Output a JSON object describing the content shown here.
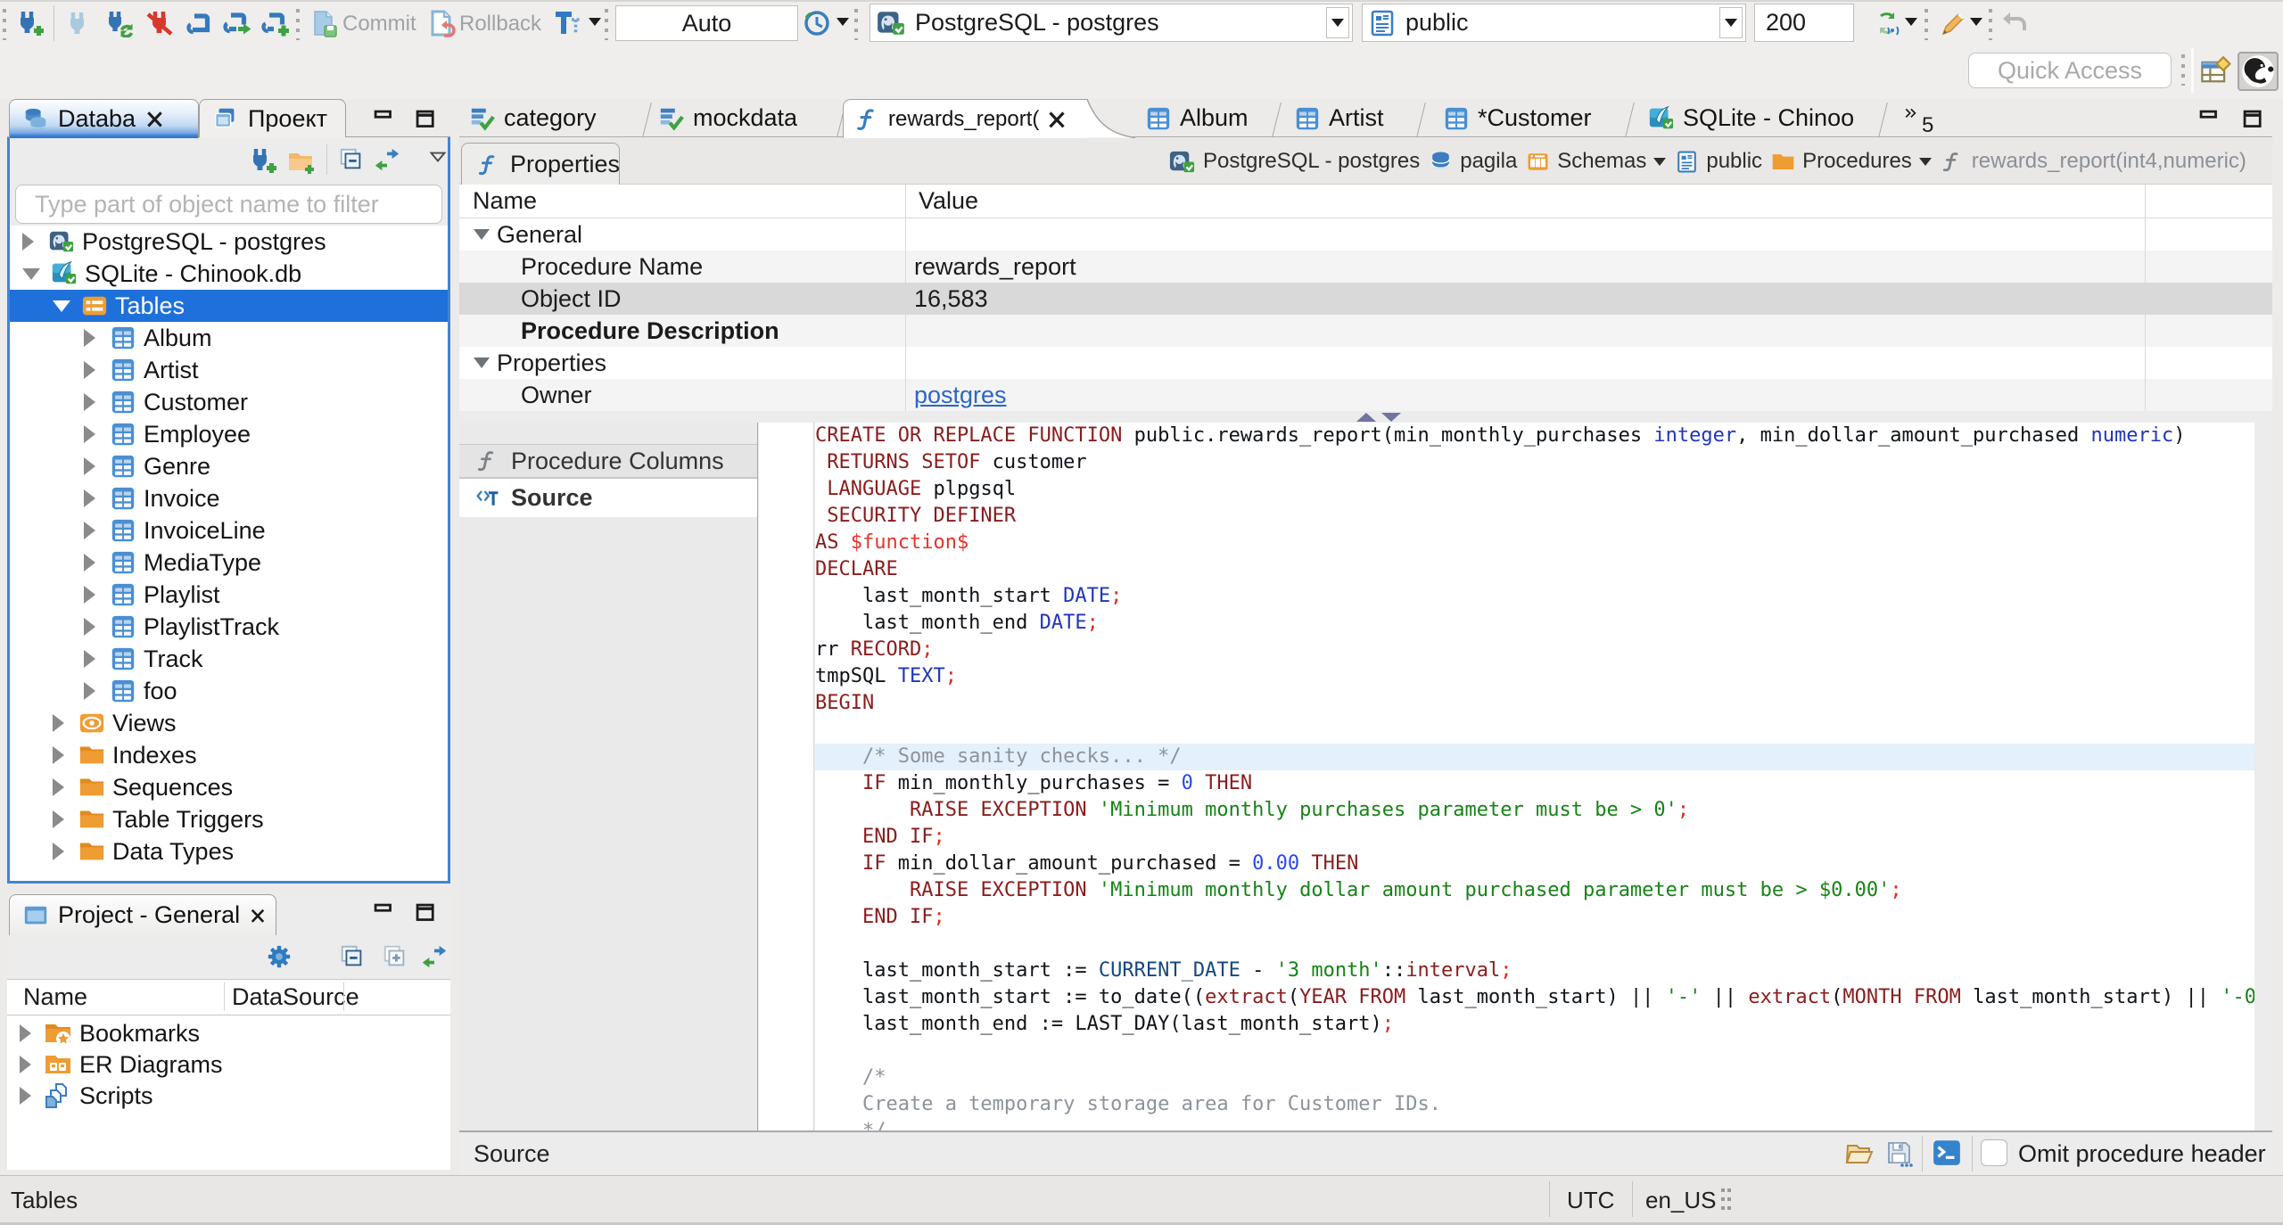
{
  "colors": {
    "selection_blue": "#1e70db",
    "focus_border_blue": "#4285d2",
    "icon_blue": "#3a7dc2",
    "folder_orange": "#ef9c33",
    "accent_green": "#3fa142",
    "accent_red": "#d64541",
    "code_keyword": "#8b1c1c",
    "code_type": "#2036b8",
    "code_number": "#2a49e8",
    "code_string": "#168316",
    "code_comment": "#8d939b",
    "code_delimiter": "#e02a22",
    "code_dollar_quote": "#e5342b",
    "code_builtin": "#15477f"
  },
  "toolbar": {
    "buttons": [
      {
        "icon": "plug-new-icon",
        "name": "new-connection-button"
      },
      {
        "icon": "plug-idle-icon",
        "name": "connect-button"
      },
      {
        "icon": "plug-refresh-icon",
        "name": "invalidate-connection-button"
      },
      {
        "icon": "plug-disconnect-icon",
        "name": "disconnect-button"
      },
      {
        "icon": "sql-editor-icon",
        "name": "sql-editor-button"
      },
      {
        "icon": "sql-editor-open-icon",
        "name": "open-sql-script-button"
      },
      {
        "icon": "sql-editor-new-icon",
        "name": "new-sql-editor-button"
      }
    ],
    "commit_label": "Commit",
    "rollback_label": "Rollback",
    "tx_mode_combo": "Auto",
    "connection_combo": "PostgreSQL - postgres",
    "schema_combo": "public",
    "fetch_size_value": "200",
    "quick_access_placeholder": "Quick Access"
  },
  "left_view_tabs": [
    {
      "label": "Databa",
      "icon": "database-stack-icon",
      "closable": true,
      "selected": true
    },
    {
      "label": "Проект",
      "icon": "projects-icon",
      "closable": false,
      "selected": false
    }
  ],
  "navigator": {
    "filter_placeholder": "Type part of object name to filter",
    "tree": [
      {
        "label": "PostgreSQL - postgres",
        "icon": "postgres-connection-icon",
        "level": 0,
        "arrow": "right"
      },
      {
        "label": "SQLite - Chinook.db",
        "icon": "sqlite-connection-icon",
        "level": 0,
        "arrow": "down"
      },
      {
        "label": "Tables",
        "icon": "tables-folder-icon",
        "level": 1,
        "arrow": "down",
        "selected": true
      },
      {
        "label": "Album",
        "icon": "table-icon",
        "level": 2,
        "arrow": "right"
      },
      {
        "label": "Artist",
        "icon": "table-icon",
        "level": 2,
        "arrow": "right"
      },
      {
        "label": "Customer",
        "icon": "table-icon",
        "level": 2,
        "arrow": "right"
      },
      {
        "label": "Employee",
        "icon": "table-icon",
        "level": 2,
        "arrow": "right"
      },
      {
        "label": "Genre",
        "icon": "table-icon",
        "level": 2,
        "arrow": "right"
      },
      {
        "label": "Invoice",
        "icon": "table-icon",
        "level": 2,
        "arrow": "right"
      },
      {
        "label": "InvoiceLine",
        "icon": "table-icon",
        "level": 2,
        "arrow": "right"
      },
      {
        "label": "MediaType",
        "icon": "table-icon",
        "level": 2,
        "arrow": "right"
      },
      {
        "label": "Playlist",
        "icon": "table-icon",
        "level": 2,
        "arrow": "right"
      },
      {
        "label": "PlaylistTrack",
        "icon": "table-icon",
        "level": 2,
        "arrow": "right"
      },
      {
        "label": "Track",
        "icon": "table-icon",
        "level": 2,
        "arrow": "right"
      },
      {
        "label": "foo",
        "icon": "table-icon",
        "level": 2,
        "arrow": "right"
      },
      {
        "label": "Views",
        "icon": "views-icon",
        "level": 1,
        "arrow": "right"
      },
      {
        "label": "Indexes",
        "icon": "folder-icon",
        "level": 1,
        "arrow": "right"
      },
      {
        "label": "Sequences",
        "icon": "folder-icon",
        "level": 1,
        "arrow": "right"
      },
      {
        "label": "Table Triggers",
        "icon": "folder-icon",
        "level": 1,
        "arrow": "right"
      },
      {
        "label": "Data Types",
        "icon": "folder-icon",
        "level": 1,
        "arrow": "right"
      }
    ]
  },
  "project_panel": {
    "title": "Project - General",
    "columns": [
      "Name",
      "DataSource"
    ],
    "items": [
      {
        "label": "Bookmarks",
        "icon": "bookmarks-folder-icon"
      },
      {
        "label": "ER Diagrams",
        "icon": "er-diagrams-icon"
      },
      {
        "label": "Scripts",
        "icon": "scripts-icon"
      }
    ]
  },
  "editor_tabs": [
    {
      "label": "category",
      "icon": "sql-script-icon"
    },
    {
      "label": "mockdata",
      "icon": "sql-script-icon"
    },
    {
      "label": "rewards_report(",
      "icon": "function-icon",
      "selected": true,
      "closable": true
    },
    {
      "label": "Album",
      "icon": "table-tab-icon"
    },
    {
      "label": "Artist",
      "icon": "table-tab-icon"
    },
    {
      "label": "*Customer",
      "icon": "table-tab-icon"
    },
    {
      "label": "SQLite - Chinoo",
      "icon": "sqlite-connection-icon"
    }
  ],
  "editor_tabs_overflow_count": "5",
  "properties_view_tab": "Properties",
  "breadcrumb": [
    {
      "label": "PostgreSQL - postgres",
      "icon": "postgres-connection-icon"
    },
    {
      "label": "pagila",
      "icon": "database-icon"
    },
    {
      "label": "Schemas",
      "icon": "schemas-icon",
      "dropdown": true
    },
    {
      "label": "public",
      "icon": "schema-page-icon"
    },
    {
      "label": "Procedures",
      "icon": "folder-plain-icon",
      "dropdown": true
    },
    {
      "label": "rewards_report(int4,numeric)",
      "icon": "function-gray-icon",
      "dim": true
    }
  ],
  "properties": {
    "columns": [
      "Name",
      "Value"
    ],
    "rows": [
      {
        "name": "General",
        "value": "",
        "group": true
      },
      {
        "name": "Procedure Name",
        "value": "rewards_report",
        "stripe": true
      },
      {
        "name": "Object ID",
        "value": "16,583",
        "selected": true
      },
      {
        "name": "Procedure Description",
        "value": "",
        "bold": true,
        "stripe": true
      },
      {
        "name": "Properties",
        "value": "",
        "group": true
      },
      {
        "name": "Owner",
        "value": "postgres",
        "stripe": true,
        "link": true
      }
    ]
  },
  "subtabs": [
    {
      "label": "Procedure Columns",
      "icon": "function-gray-icon"
    },
    {
      "label": "Source",
      "icon": "source-text-icon",
      "selected": true
    }
  ],
  "editor_footer": {
    "label": "Source",
    "icons": [
      "open-folder-icon",
      "save-floppy-icon",
      "terminal-icon"
    ],
    "checkbox_label": "Omit procedure header",
    "checkbox_checked": false
  },
  "statusbar": {
    "left": "Tables",
    "timezone": "UTC",
    "locale": "en_US"
  },
  "code": {
    "highlight_line": 13,
    "lines": [
      [
        {
          "t": "kw",
          "s": "CREATE OR REPLACE FUNCTION"
        },
        {
          "t": "plain",
          "s": " public.rewards_report(min_monthly_purchases "
        },
        {
          "t": "type",
          "s": "integer"
        },
        {
          "t": "plain",
          "s": ", min_dollar_amount_purchased "
        },
        {
          "t": "type",
          "s": "numeric"
        },
        {
          "t": "plain",
          "s": ")"
        }
      ],
      [
        {
          "t": "plain",
          "s": " "
        },
        {
          "t": "kw",
          "s": "RETURNS SETOF"
        },
        {
          "t": "plain",
          "s": " customer"
        }
      ],
      [
        {
          "t": "plain",
          "s": " "
        },
        {
          "t": "kw",
          "s": "LANGUAGE"
        },
        {
          "t": "plain",
          "s": " plpgsql"
        }
      ],
      [
        {
          "t": "plain",
          "s": " "
        },
        {
          "t": "kw",
          "s": "SECURITY DEFINER"
        }
      ],
      [
        {
          "t": "kw",
          "s": "AS"
        },
        {
          "t": "plain",
          "s": " "
        },
        {
          "t": "red",
          "s": "$function$"
        }
      ],
      [
        {
          "t": "kw",
          "s": "DECLARE"
        }
      ],
      [
        {
          "t": "plain",
          "s": "    last_month_start "
        },
        {
          "t": "type",
          "s": "DATE"
        },
        {
          "t": "delim",
          "s": ";"
        }
      ],
      [
        {
          "t": "plain",
          "s": "    last_month_end "
        },
        {
          "t": "type",
          "s": "DATE"
        },
        {
          "t": "delim",
          "s": ";"
        }
      ],
      [
        {
          "t": "plain",
          "s": "rr "
        },
        {
          "t": "kw",
          "s": "RECORD"
        },
        {
          "t": "delim",
          "s": ";"
        }
      ],
      [
        {
          "t": "plain",
          "s": "tmpSQL "
        },
        {
          "t": "type",
          "s": "TEXT"
        },
        {
          "t": "delim",
          "s": ";"
        }
      ],
      [
        {
          "t": "kw",
          "s": "BEGIN"
        }
      ],
      [],
      [
        {
          "t": "com",
          "s": "    /* Some sanity checks... */"
        }
      ],
      [
        {
          "t": "plain",
          "s": "    "
        },
        {
          "t": "kw",
          "s": "IF"
        },
        {
          "t": "plain",
          "s": " min_monthly_purchases = "
        },
        {
          "t": "num",
          "s": "0"
        },
        {
          "t": "plain",
          "s": " "
        },
        {
          "t": "kw",
          "s": "THEN"
        }
      ],
      [
        {
          "t": "plain",
          "s": "        "
        },
        {
          "t": "kw",
          "s": "RAISE EXCEPTION"
        },
        {
          "t": "plain",
          "s": " "
        },
        {
          "t": "str",
          "s": "'Minimum monthly purchases parameter must be > 0'"
        },
        {
          "t": "delim",
          "s": ";"
        }
      ],
      [
        {
          "t": "plain",
          "s": "    "
        },
        {
          "t": "kw",
          "s": "END IF"
        },
        {
          "t": "delim",
          "s": ";"
        }
      ],
      [
        {
          "t": "plain",
          "s": "    "
        },
        {
          "t": "kw",
          "s": "IF"
        },
        {
          "t": "plain",
          "s": " min_dollar_amount_purchased = "
        },
        {
          "t": "num",
          "s": "0.00"
        },
        {
          "t": "plain",
          "s": " "
        },
        {
          "t": "kw",
          "s": "THEN"
        }
      ],
      [
        {
          "t": "plain",
          "s": "        "
        },
        {
          "t": "kw",
          "s": "RAISE EXCEPTION"
        },
        {
          "t": "plain",
          "s": " "
        },
        {
          "t": "str",
          "s": "'Minimum monthly dollar amount purchased parameter must be > $0.00'"
        },
        {
          "t": "delim",
          "s": ";"
        }
      ],
      [
        {
          "t": "plain",
          "s": "    "
        },
        {
          "t": "kw",
          "s": "END IF"
        },
        {
          "t": "delim",
          "s": ";"
        }
      ],
      [],
      [
        {
          "t": "plain",
          "s": "    last_month_start := "
        },
        {
          "t": "special",
          "s": "CURRENT_DATE"
        },
        {
          "t": "plain",
          "s": " - "
        },
        {
          "t": "str",
          "s": "'3 month'"
        },
        {
          "t": "plain",
          "s": "::"
        },
        {
          "t": "kw",
          "s": "interval"
        },
        {
          "t": "delim",
          "s": ";"
        }
      ],
      [
        {
          "t": "plain",
          "s": "    last_month_start := to_date(("
        },
        {
          "t": "kw",
          "s": "extract"
        },
        {
          "t": "plain",
          "s": "("
        },
        {
          "t": "kw",
          "s": "YEAR FROM"
        },
        {
          "t": "plain",
          "s": " last_month_start) || "
        },
        {
          "t": "str",
          "s": "'-'"
        },
        {
          "t": "plain",
          "s": " || "
        },
        {
          "t": "kw",
          "s": "extract"
        },
        {
          "t": "plain",
          "s": "("
        },
        {
          "t": "kw",
          "s": "MONTH FROM"
        },
        {
          "t": "plain",
          "s": " last_month_start) || "
        },
        {
          "t": "str",
          "s": "'-0"
        }
      ],
      [
        {
          "t": "plain",
          "s": "    last_month_end := LAST_DAY(last_month_start)"
        },
        {
          "t": "delim",
          "s": ";"
        }
      ],
      [],
      [
        {
          "t": "com",
          "s": "    /*"
        }
      ],
      [
        {
          "t": "com",
          "s": "    Create a temporary storage area for Customer IDs."
        }
      ],
      [
        {
          "t": "com",
          "s": "    */"
        }
      ]
    ]
  }
}
